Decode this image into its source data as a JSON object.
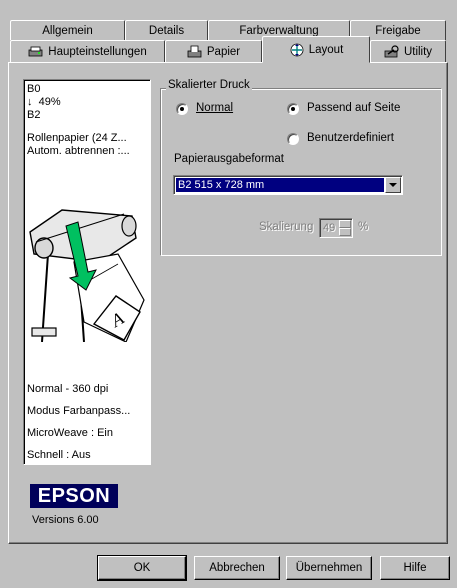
{
  "tabs_row1": [
    {
      "label": "Allgemein"
    },
    {
      "label": "Details"
    },
    {
      "label": "Farbverwaltung"
    },
    {
      "label": "Freigabe"
    }
  ],
  "tabs_row2": [
    {
      "label": "Haupteinstellungen",
      "icon": "settings-icon"
    },
    {
      "label": "Papier",
      "icon": "paper-icon"
    },
    {
      "label": "Layout",
      "icon": "layout-icon",
      "active": true
    },
    {
      "label": "Utility",
      "icon": "utility-icon"
    }
  ],
  "preview": {
    "source_size": "B0",
    "arrow": "↓",
    "scale": "49%",
    "target_size": "B2",
    "paper_line1": "Rollenpapier (24 Z...",
    "paper_line2": "Autom. abtrennen :...",
    "status": [
      "Normal - 360 dpi",
      "Modus Farbanpass...",
      "MicroWeave : Ein",
      "Schnell : Aus"
    ]
  },
  "scaled_print": {
    "group_label": "Skalierter Druck",
    "option_normal": "Normal",
    "option_fit": "Passend auf Seite",
    "option_custom": "Benutzerdefiniert",
    "format_label": "Papierausgabeformat",
    "format_value": "B2 515 x 728 mm",
    "scaling_label": "Skalierung",
    "scaling_value": "49",
    "scaling_unit": "%"
  },
  "brand": {
    "logo": "EPSON",
    "version": "Versions 6.00",
    "color": "#00005a"
  },
  "buttons": {
    "ok": "OK",
    "cancel": "Abbrechen",
    "apply": "Übernehmen",
    "help": "Hilfe"
  }
}
